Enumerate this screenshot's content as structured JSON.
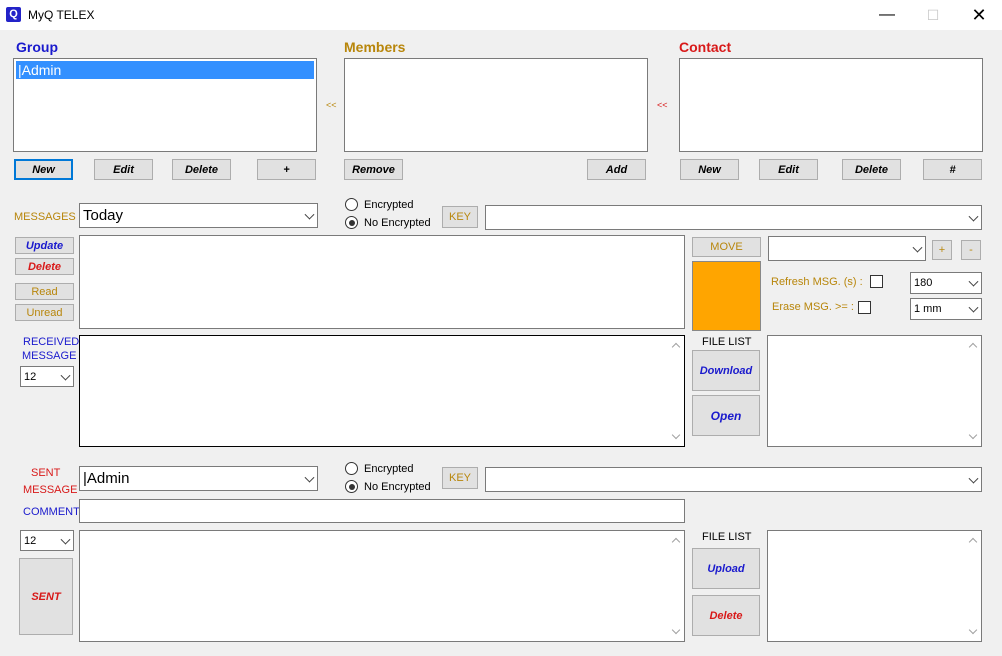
{
  "window": {
    "title": "MyQ TELEX",
    "icon_letter": "Q",
    "minimize": "—",
    "maximize": "☐",
    "close": "✕"
  },
  "group": {
    "header": "Group",
    "items": [
      "|Admin"
    ],
    "buttons": {
      "new": "New",
      "edit": "Edit",
      "delete": "Delete",
      "plus": "+"
    }
  },
  "members": {
    "header": "Members",
    "arrow_left": "<<",
    "buttons": {
      "remove": "Remove",
      "add": "Add"
    }
  },
  "contact": {
    "header": "Contact",
    "arrow_left": "<<",
    "buttons": {
      "new": "New",
      "edit": "Edit",
      "delete": "Delete",
      "hash": "#"
    }
  },
  "messages": {
    "label": "MESSAGES",
    "filter_value": "Today",
    "encrypted_label": "Encrypted",
    "no_encrypted_label": "No Encrypted",
    "selected_encryption": "No Encrypted",
    "key_button": "KEY",
    "key_value": "",
    "buttons": {
      "update": "Update",
      "delete": "Delete",
      "read": "Read",
      "unread": "Unread"
    },
    "move_button": "MOVE",
    "move_target": "",
    "plus_button": "+",
    "minus_button": "-",
    "refresh_label": "Refresh MSG. (s) :",
    "refresh_checked": false,
    "refresh_value": "180",
    "erase_label": "Erase MSG. >= :",
    "erase_checked": false,
    "erase_value": "1 mm",
    "status_color": "#ffa500"
  },
  "received": {
    "label_line1": "RECEIVED",
    "label_line2": "MESSAGE",
    "font_size": "12",
    "file_list_label": "FILE LIST",
    "download_button": "Download",
    "open_button": "Open"
  },
  "sent": {
    "label_line1": "SENT",
    "label_line2": "MESSAGE",
    "recipient_value": "|Admin",
    "encrypted_label": "Encrypted",
    "no_encrypted_label": "No Encrypted",
    "selected_encryption": "No Encrypted",
    "key_button": "KEY",
    "key_value": "",
    "comment_label": "COMMENT",
    "comment_value": "",
    "font_size": "12",
    "sent_button": "SENT",
    "file_list_label": "FILE LIST",
    "upload_button": "Upload",
    "delete_button": "Delete"
  }
}
